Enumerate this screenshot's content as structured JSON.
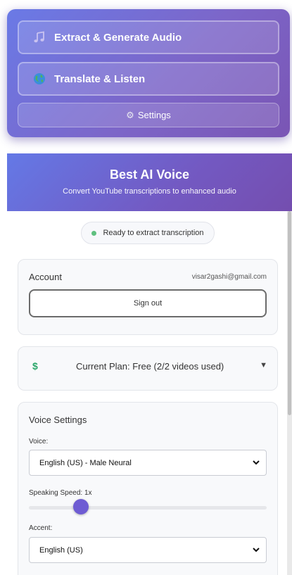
{
  "widget": {
    "extract_label": "Extract & Generate Audio",
    "translate_label": "Translate & Listen",
    "settings_label": "Settings",
    "extract_icon": "music-note-icon",
    "translate_icon": "globe-icon",
    "settings_icon": "gear-icon"
  },
  "header": {
    "title": "Best AI Voice",
    "subtitle": "Convert YouTube transcriptions to enhanced audio"
  },
  "status": {
    "text": "Ready to extract transcription",
    "dot_color": "#5fc07f"
  },
  "account": {
    "label": "Account",
    "email": "visar2gashi@gmail.com",
    "sign_out_label": "Sign out"
  },
  "plan": {
    "icon": "$",
    "text": "Current Plan: Free (2/2 videos used)",
    "arrow": "▼"
  },
  "voice_settings": {
    "title": "Voice Settings",
    "voice_label": "Voice:",
    "voice_value": "English (US) - Male Neural",
    "speed_label": "Speaking Speed: 1x",
    "speed_fraction": 0.22,
    "accent_label": "Accent:",
    "accent_value": "English (US)"
  },
  "colors": {
    "accent": "#6e5cd3",
    "header_start": "#6479e6",
    "header_end": "#744eaf"
  }
}
